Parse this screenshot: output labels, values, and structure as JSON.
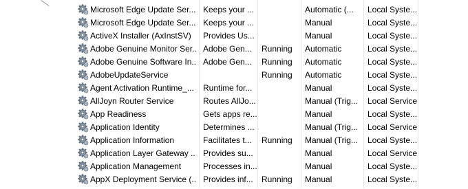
{
  "services": {
    "rows": [
      {
        "name": "Microsoft Edge Update Ser...",
        "description": "Keeps your ...",
        "status": "",
        "startup_type": "Automatic (...",
        "log_on_as": "Local Syste..."
      },
      {
        "name": "Microsoft Edge Update Ser...",
        "description": "Keeps your ...",
        "status": "",
        "startup_type": "Manual",
        "log_on_as": "Local Syste..."
      },
      {
        "name": "ActiveX Installer (AxInstSV)",
        "description": "Provides Us...",
        "status": "",
        "startup_type": "Manual",
        "log_on_as": "Local Syste..."
      },
      {
        "name": "Adobe Genuine Monitor Ser...",
        "description": "Adobe Gen...",
        "status": "Running",
        "startup_type": "Automatic",
        "log_on_as": "Local Syste..."
      },
      {
        "name": "Adobe Genuine Software In...",
        "description": "Adobe Gen...",
        "status": "Running",
        "startup_type": "Automatic",
        "log_on_as": "Local Syste..."
      },
      {
        "name": "AdobeUpdateService",
        "description": "",
        "status": "Running",
        "startup_type": "Automatic",
        "log_on_as": "Local Syste..."
      },
      {
        "name": "Agent Activation Runtime_...",
        "description": "Runtime for...",
        "status": "",
        "startup_type": "Manual",
        "log_on_as": "Local Syste..."
      },
      {
        "name": "AllJoyn Router Service",
        "description": "Routes AllJo...",
        "status": "",
        "startup_type": "Manual (Trig...",
        "log_on_as": "Local Service"
      },
      {
        "name": "App Readiness",
        "description": "Gets apps re...",
        "status": "",
        "startup_type": "Manual",
        "log_on_as": "Local Syste..."
      },
      {
        "name": "Application Identity",
        "description": "Determines ...",
        "status": "",
        "startup_type": "Manual (Trig...",
        "log_on_as": "Local Service"
      },
      {
        "name": "Application Information",
        "description": "Facilitates t...",
        "status": "Running",
        "startup_type": "Manual (Trig...",
        "log_on_as": "Local Syste..."
      },
      {
        "name": "Application Layer Gateway ...",
        "description": "Provides su...",
        "status": "",
        "startup_type": "Manual",
        "log_on_as": "Local Service"
      },
      {
        "name": "Application Management",
        "description": "Processes in...",
        "status": "",
        "startup_type": "Manual",
        "log_on_as": "Local Syste..."
      },
      {
        "name": "AppX Deployment Service (...",
        "description": "Provides inf...",
        "status": "Running",
        "startup_type": "Manual",
        "log_on_as": "Local Syste..."
      }
    ],
    "icon": "gear-icon"
  }
}
